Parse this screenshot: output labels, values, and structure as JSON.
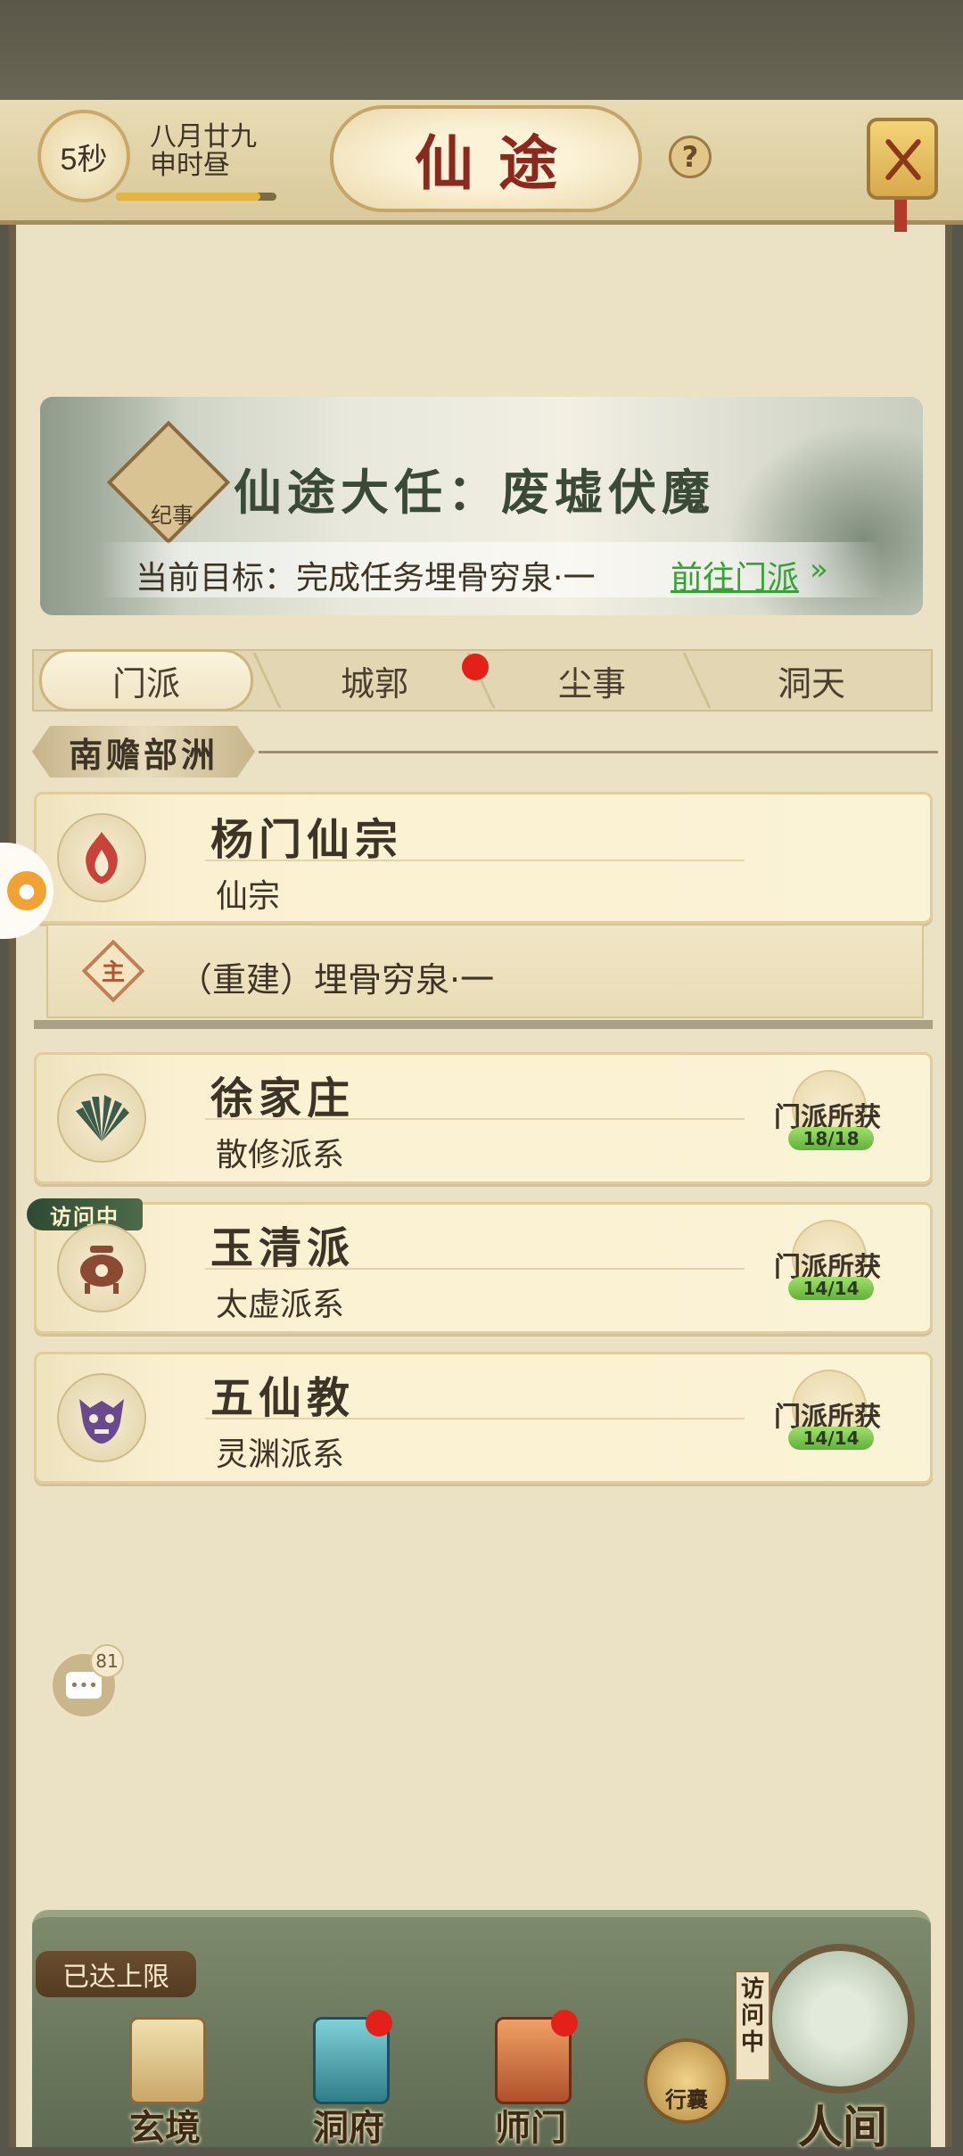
{
  "header": {
    "timer": "5秒",
    "date_line1": "八月廿九",
    "date_line2": "申时昼",
    "title": "仙途",
    "help": "?",
    "time_progress": 0.9
  },
  "quest": {
    "badge_label": "纪事",
    "title": "仙途大任：废墟伏魔",
    "goal": "当前目标：完成任务埋骨穷泉·一",
    "link": "前往门派",
    "link_arrow": "»"
  },
  "tabs": [
    {
      "label": "门派",
      "active": true
    },
    {
      "label": "城郭",
      "has_dot": true
    },
    {
      "label": "尘事"
    },
    {
      "label": "洞天"
    }
  ],
  "region": "南赡部洲",
  "sects": [
    {
      "name": "杨门仙宗",
      "type": "仙宗",
      "emblem": "flame-emblem-icon"
    },
    {
      "name": "徐家庄",
      "type": "散修派系",
      "emblem": "leaf-fan-emblem-icon",
      "reward_label": "门派所获",
      "reward_count": "18/18"
    },
    {
      "name": "玉清派",
      "type": "太虚派系",
      "emblem": "cauldron-emblem-icon",
      "reward_label": "门派所获",
      "reward_count": "14/14",
      "tag": "访问中"
    },
    {
      "name": "五仙教",
      "type": "灵渊派系",
      "emblem": "demon-mask-emblem-icon",
      "reward_label": "门派所获",
      "reward_count": "14/14"
    }
  ],
  "sub_task": {
    "badge": "主",
    "text": "（重建）埋骨穷泉·一"
  },
  "chat": {
    "count": "81"
  },
  "bottom_nav": {
    "limit_tag": "已达上限",
    "items": [
      {
        "label": "玄境",
        "icon": "scroll-icon"
      },
      {
        "label": "洞府",
        "icon": "pavilion-icon",
        "has_dot": true
      },
      {
        "label": "师门",
        "icon": "banner-icon",
        "has_dot": true
      }
    ],
    "bag_label": "行囊",
    "world_label": "人间",
    "visiting_vertical": "访问中"
  },
  "colors": {
    "accent_red": "#e3201a",
    "link_green": "#35a233",
    "title_red": "#8a2a1e",
    "panel_bg": "#ebe1c4"
  }
}
